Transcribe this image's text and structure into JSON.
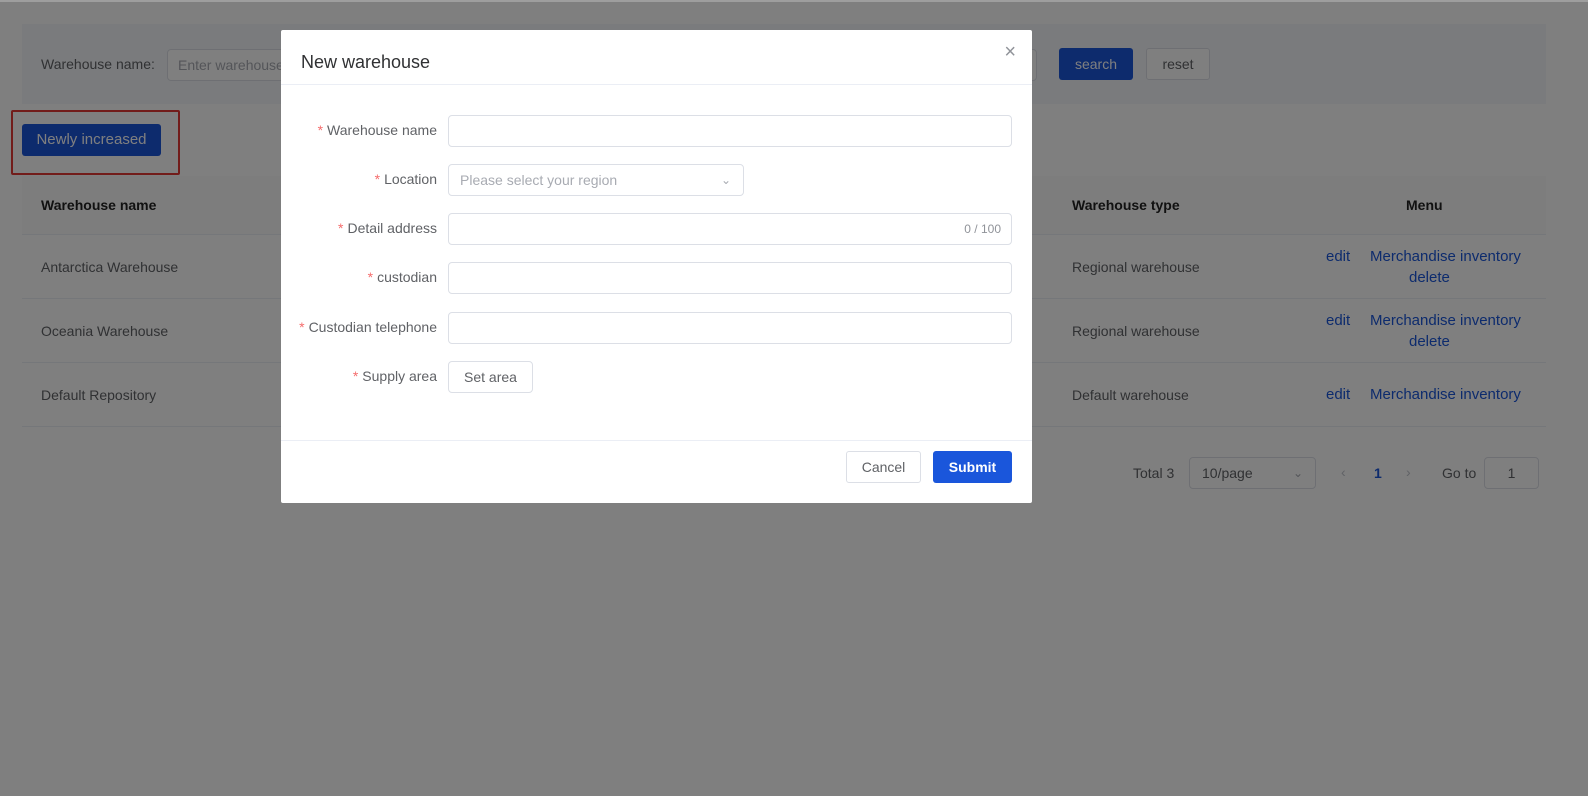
{
  "filter": {
    "label": "Warehouse name:",
    "placeholder": "Enter warehouse name",
    "search_label": "search",
    "reset_label": "reset"
  },
  "toolbar": {
    "new_label": "Newly increased"
  },
  "table": {
    "headers": {
      "name": "Warehouse name",
      "type": "Warehouse type",
      "menu": "Menu"
    },
    "rows": [
      {
        "name": "Antarctica Warehouse",
        "type": "Regional warehouse",
        "edit": "edit",
        "inventory": "Merchandise inventory",
        "delete": "delete"
      },
      {
        "name": "Oceania Warehouse",
        "type": "Regional warehouse",
        "edit": "edit",
        "inventory": "Merchandise inventory",
        "delete": "delete"
      },
      {
        "name": "Default Repository",
        "type": "Default warehouse",
        "edit": "edit",
        "inventory": "Merchandise inventory"
      }
    ]
  },
  "pagination": {
    "total": "Total 3",
    "page_size": "10/page",
    "current_page": "1",
    "goto_label": "Go to",
    "goto_value": "1"
  },
  "modal": {
    "title": "New warehouse",
    "close_icon": "close-icon",
    "fields": {
      "warehouse_name": {
        "label": "Warehouse name",
        "value": ""
      },
      "location": {
        "label": "Location",
        "placeholder": "Please select your region"
      },
      "detail_address": {
        "label": "Detail address",
        "counter": "0 / 100"
      },
      "custodian": {
        "label": "custodian",
        "value": ""
      },
      "custodian_telephone": {
        "label": "Custodian telephone",
        "value": ""
      },
      "supply_area": {
        "label": "Supply area",
        "button": "Set area"
      }
    },
    "required_mark": "*",
    "cancel_label": "Cancel",
    "submit_label": "Submit"
  },
  "colors": {
    "primary": "#1a56db",
    "required": "#f56c6c",
    "highlight": "#e53935"
  }
}
